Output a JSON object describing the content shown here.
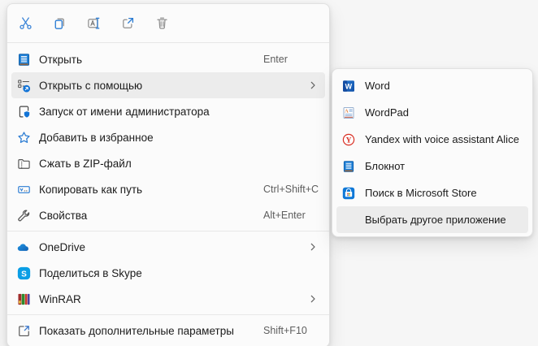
{
  "colors": {
    "accent_blue": "#2b7cd3",
    "menu_background": "#fbfbfb",
    "highlight": "#ececec",
    "text_primary": "#1b1b1b",
    "text_secondary": "#5d5d5d"
  },
  "toolbar": {
    "icons": [
      "cut",
      "copy",
      "rename",
      "share",
      "delete"
    ]
  },
  "main_menu": {
    "items": [
      {
        "label": "Открыть",
        "icon": "notepad",
        "shortcut": "Enter"
      },
      {
        "label": "Открыть с помощью",
        "icon": "open-with",
        "has_submenu": true,
        "highlighted": true
      },
      {
        "label": "Запуск от имени администратора",
        "icon": "admin-shield"
      },
      {
        "label": "Добавить в избранное",
        "icon": "star"
      },
      {
        "label": "Сжать в ZIP-файл",
        "icon": "zip-folder"
      },
      {
        "label": "Копировать как путь",
        "icon": "copy-path",
        "shortcut": "Ctrl+Shift+C"
      },
      {
        "label": "Свойства",
        "icon": "wrench",
        "shortcut": "Alt+Enter"
      },
      {
        "label": "OneDrive",
        "icon": "onedrive-cloud",
        "has_submenu": true
      },
      {
        "label": "Поделиться в Skype",
        "icon": "skype"
      },
      {
        "label": "WinRAR",
        "icon": "winrar",
        "has_submenu": true
      },
      {
        "label": "Показать дополнительные параметры",
        "icon": "external-arrow",
        "shortcut": "Shift+F10"
      }
    ]
  },
  "submenu": {
    "items": [
      {
        "label": "Word",
        "icon": "word"
      },
      {
        "label": "WordPad",
        "icon": "wordpad"
      },
      {
        "label": "Yandex with voice assistant Alice",
        "icon": "yandex"
      },
      {
        "label": "Блокнот",
        "icon": "notepad"
      },
      {
        "label": "Поиск в Microsoft Store",
        "icon": "microsoft-store"
      },
      {
        "label": "Выбрать другое приложение",
        "icon": null,
        "highlighted": true
      }
    ]
  }
}
